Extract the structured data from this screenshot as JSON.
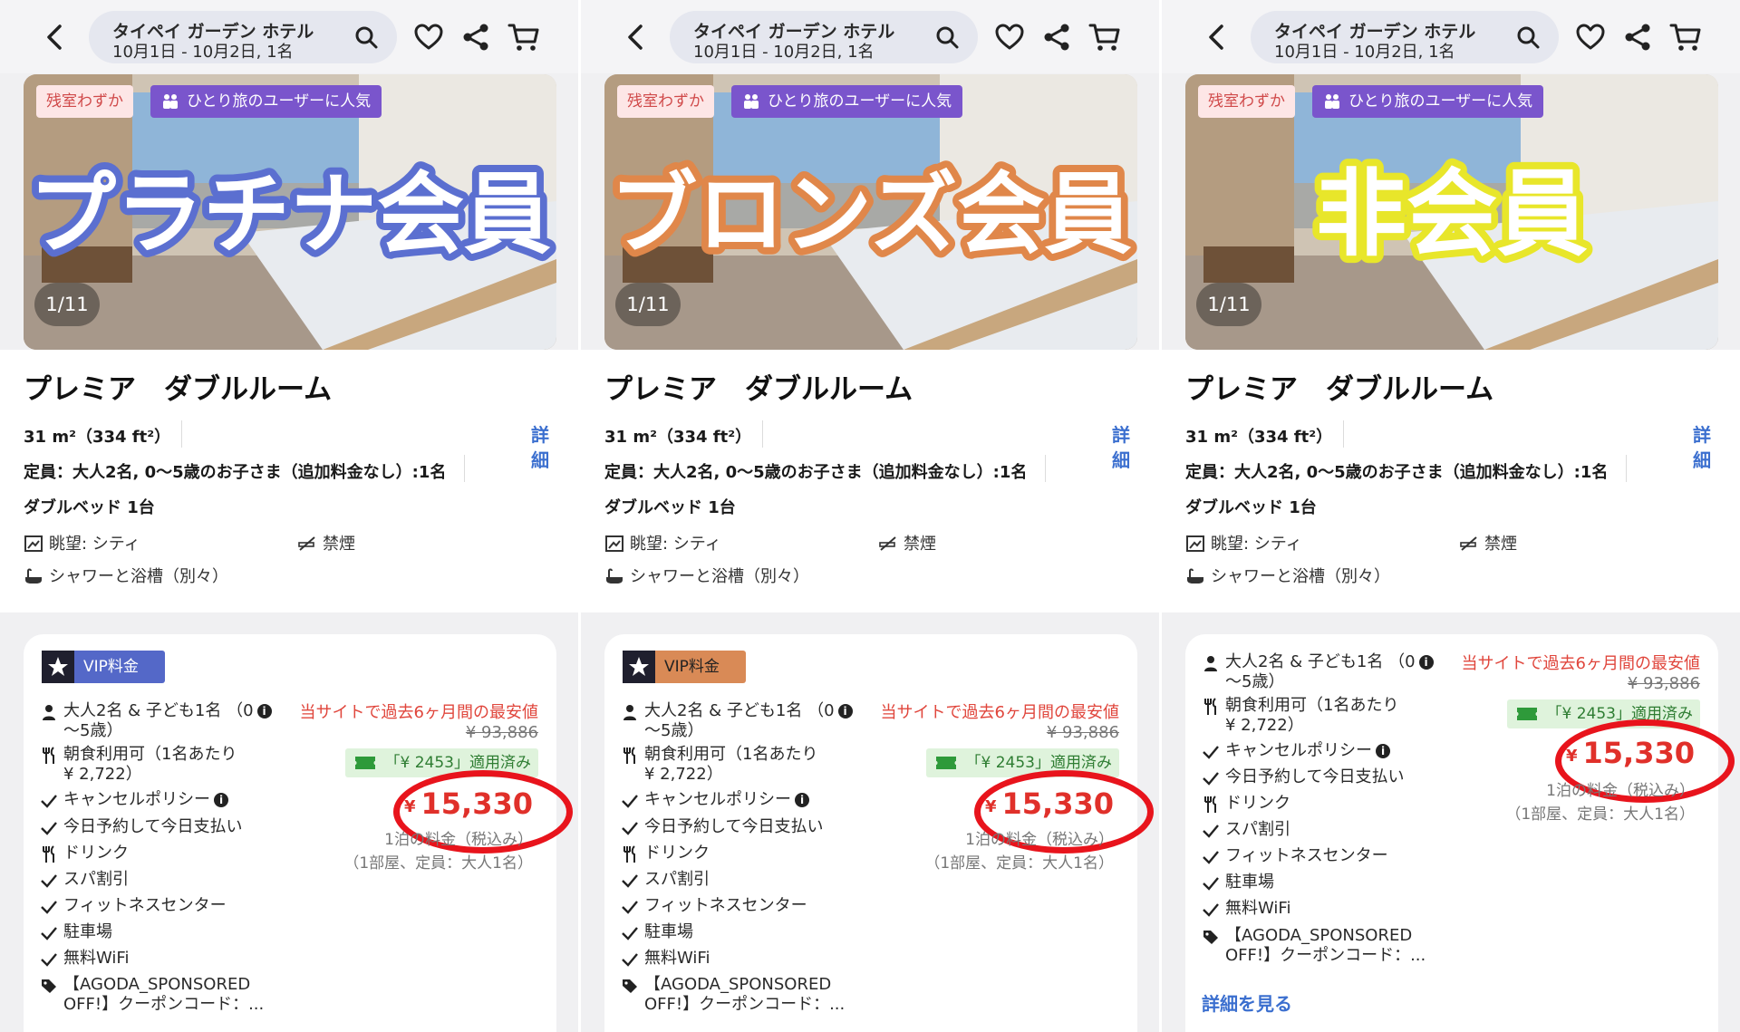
{
  "header": {
    "hotel_name": "タイペイ ガーデン ホテル",
    "stay_info": "10月1日 - 10月2日, 1名"
  },
  "room": {
    "badge_low": "残室わずか",
    "badge_solo": "ひとり旅のユーザーに人気",
    "photo_counter": "1/11",
    "title": "プレミア　ダブルルーム",
    "size": "31 m²（334 ft²）",
    "capacity": "定員：大人2名, 0〜5歳のお子さま（追加料金なし）:1名",
    "bed": "ダブルベッド 1台",
    "detail_link": "詳細",
    "amenities": {
      "view": "眺望: シティ",
      "smoking": "禁煙",
      "bath": "シャワーと浴槽（別々）"
    }
  },
  "panels": [
    {
      "overlay_title": "プラチナ会員",
      "overlay_color": "#5b6fd0",
      "vip_label": "VIP料金"
    },
    {
      "overlay_title": "ブロンズ会員",
      "overlay_color": "#e0874a",
      "vip_label": "VIP料金"
    },
    {
      "overlay_title": "非会員",
      "overlay_color": "#e8e62a",
      "vip_label": ""
    }
  ],
  "rate": {
    "guests_line1": "大人2名 & 子ども1名 （0",
    "guests_line2": "〜5歳）",
    "breakfast_line1": "朝食利用可（1名あたり",
    "breakfast_line2": "¥ 2,722）",
    "cancel_policy": "キャンセルポリシー",
    "pay_today": "今日予約して今日支払い",
    "drink": "ドリンク",
    "spa": "スパ割引",
    "fitness": "フィットネスセンター",
    "parking": "駐車場",
    "wifi": "無料WiFi",
    "coupon_code_line1": "【AGODA_SPONSORED",
    "coupon_code_line2": "OFF!】クーポンコード：...",
    "promo": "当サイトで過去6ヶ月間の最安値",
    "original_price": "¥ 93,886",
    "coupon_applied": "「¥ 2453」適用済み",
    "price_symbol": "¥",
    "price": "15,330",
    "per_night": "1泊の料金（税込み）",
    "room_note": "（1部屋、定員：大人1名）",
    "see_more": "詳細を見る"
  },
  "colors": {
    "price_red": "#e0302a",
    "circle_red": "#e8141c",
    "link_blue": "#3b6fcf",
    "platinum": "#5468c8",
    "bronze": "#d98a56",
    "nonmember": "#e8e62a"
  }
}
